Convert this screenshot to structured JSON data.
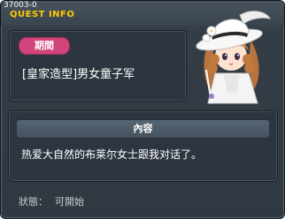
{
  "window": {
    "quest_id": "37003-0",
    "title": "QUEST INFO"
  },
  "header": {
    "period_label": "期間",
    "quest_name": "[皇家造型]男女童子军"
  },
  "character": {
    "icon": "npc-lady-white-hat-portrait"
  },
  "content": {
    "header_label": "內容",
    "text": "热爱大自然的布莱尔女士跟我对话了。"
  },
  "status": {
    "label": "狀態：",
    "value": "可開始"
  },
  "colors": {
    "accent_title": "#ffcc00",
    "badge": "#d1457a",
    "panel": "#2d3640"
  }
}
